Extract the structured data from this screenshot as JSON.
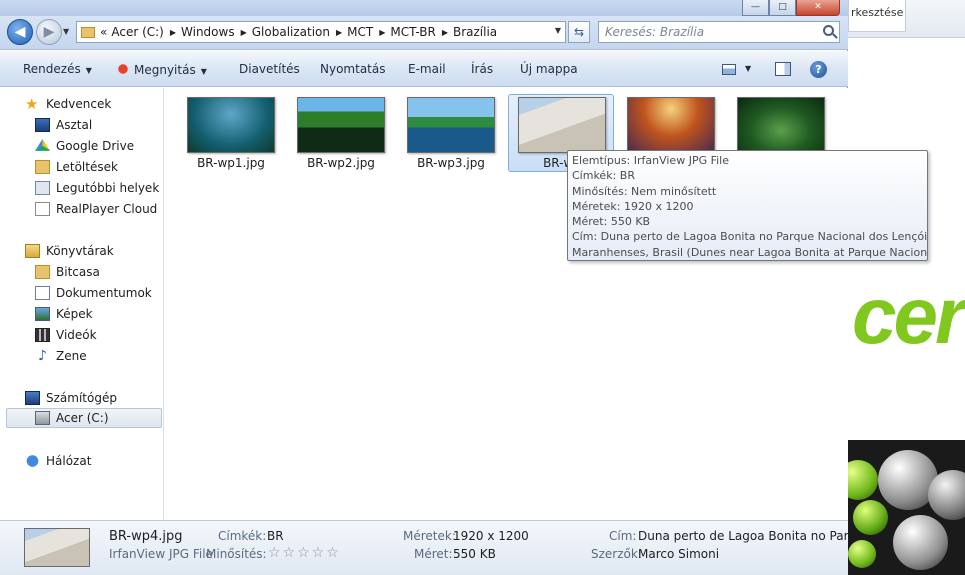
{
  "background_app": {
    "tab_label": "rkesztése",
    "brand_text": "cer"
  },
  "window_buttons": {
    "minimize": "—",
    "maximize": "□",
    "close": "✕"
  },
  "address_bar": {
    "prefix": "«",
    "crumbs": [
      "Acer (C:)",
      "Windows",
      "Globalization",
      "MCT",
      "MCT-BR",
      "Brazília"
    ]
  },
  "search": {
    "placeholder": "Keresés: Brazília"
  },
  "toolbar": {
    "organize": "Rendezés",
    "open": "Megnyitás",
    "slideshow": "Diavetítés",
    "print": "Nyomtatás",
    "email": "E-mail",
    "burn": "Írás",
    "new_folder": "Új mappa"
  },
  "sidebar": {
    "favorites": "Kedvencek",
    "desktop": "Asztal",
    "google_drive": "Google Drive",
    "downloads": "Letöltések",
    "recent": "Legutóbbi helyek",
    "realplayer": "RealPlayer Cloud",
    "libraries": "Könyvtárak",
    "bitcasa": "Bitcasa",
    "documents": "Dokumentumok",
    "pictures": "Képek",
    "videos": "Videók",
    "music": "Zene",
    "computer": "Számítógép",
    "drive_c": "Acer (C:)",
    "network": "Hálózat"
  },
  "files": [
    {
      "name": "BR-wp1.jpg"
    },
    {
      "name": "BR-wp2.jpg"
    },
    {
      "name": "BR-wp3.jpg"
    },
    {
      "name": "BR-wp"
    },
    {
      "name": ""
    },
    {
      "name": ""
    }
  ],
  "tooltip": {
    "lines": [
      "Elemtípus: IrfanView JPG File",
      "Címkék: BR",
      "Minősítés: Nem minősített",
      "Méretek: 1920 x 1200",
      "Méret: 550 KB",
      "Cím: Duna perto de Lagoa Bonita no Parque Nacional dos Lençóis",
      "Maranhenses, Brasil (Dunes near Lagoa Bonita at Parque Nacional"
    ]
  },
  "details": {
    "filename": "BR-wp4.jpg",
    "filetype": "IrfanView JPG File",
    "tags_label": "Címkék:",
    "tags_value": "BR",
    "rating_label": "Minősítés:",
    "rating_stars": "☆☆☆☆☆",
    "dims_label": "Méretek:",
    "dims_value": "1920 x 1200",
    "size_label": "Méret:",
    "size_value": "550 KB",
    "title_label": "Cím:",
    "title_value": "Duna perto de Lagoa Bonita no Par...",
    "authors_label": "Szerzők:",
    "authors_value": "Marco Simoni"
  }
}
